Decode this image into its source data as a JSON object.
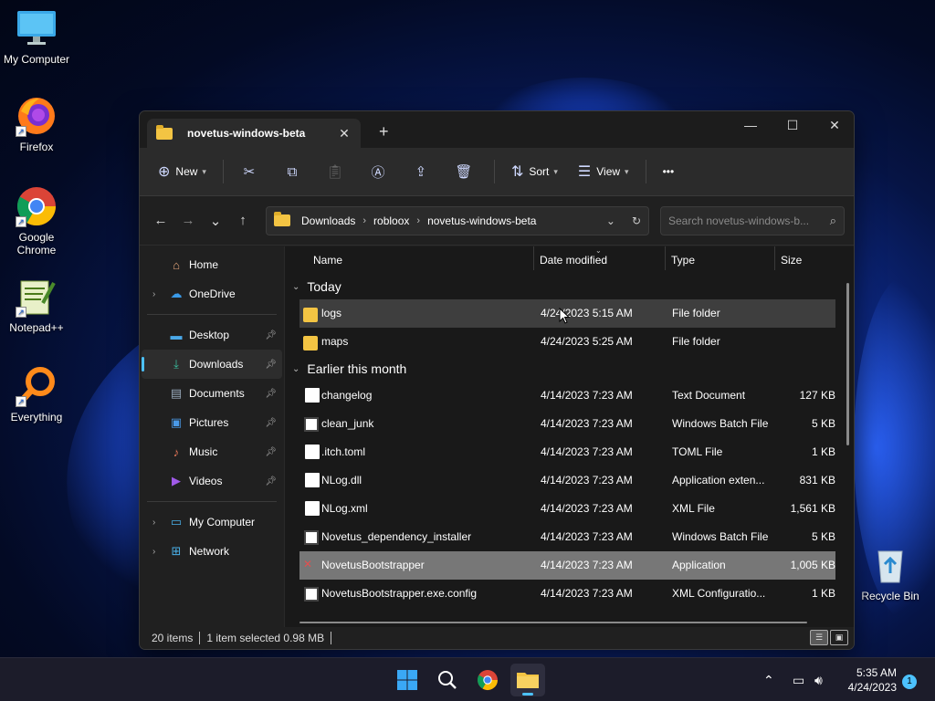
{
  "desktop": {
    "icons": [
      {
        "label": "My Computer",
        "icon": "monitor-icon"
      },
      {
        "label": "Firefox",
        "icon": "firefox-icon"
      },
      {
        "label": "Google Chrome",
        "icon": "chrome-icon"
      },
      {
        "label": "Notepad++",
        "icon": "notepadpp-icon"
      },
      {
        "label": "Everything",
        "icon": "everything-icon"
      },
      {
        "label": "Recycle Bin",
        "icon": "recycle-bin-icon"
      }
    ]
  },
  "window": {
    "tab_title": "novetus-windows-beta",
    "toolbar": {
      "new_label": "New",
      "sort_label": "Sort",
      "view_label": "View",
      "more_label": "•••"
    },
    "breadcrumb": [
      "Downloads",
      "robloox",
      "novetus-windows-beta"
    ],
    "search_placeholder": "Search novetus-windows-b...",
    "sidebar": {
      "top": [
        {
          "label": "Home",
          "icon": "home-icon"
        },
        {
          "label": "OneDrive",
          "icon": "cloud-icon"
        }
      ],
      "pinned": [
        {
          "label": "Desktop",
          "icon": "desktop-icon"
        },
        {
          "label": "Downloads",
          "icon": "download-icon"
        },
        {
          "label": "Documents",
          "icon": "documents-icon"
        },
        {
          "label": "Pictures",
          "icon": "pictures-icon"
        },
        {
          "label": "Music",
          "icon": "music-icon"
        },
        {
          "label": "Videos",
          "icon": "videos-icon"
        }
      ],
      "bottom": [
        {
          "label": "My Computer",
          "icon": "monitor-icon"
        },
        {
          "label": "Network",
          "icon": "network-icon"
        }
      ]
    },
    "columns": {
      "name": "Name",
      "date": "Date modified",
      "type": "Type",
      "size": "Size"
    },
    "groups": [
      {
        "label": "Today",
        "rows": [
          {
            "name": "logs",
            "date": "4/24/2023 5:15 AM",
            "type": "File folder",
            "size": "",
            "icon": "folder-icon"
          },
          {
            "name": "maps",
            "date": "4/24/2023 5:25 AM",
            "type": "File folder",
            "size": "",
            "icon": "folder-icon"
          }
        ]
      },
      {
        "label": "Earlier this month",
        "rows": [
          {
            "name": "changelog",
            "date": "4/14/2023 7:23 AM",
            "type": "Text Document",
            "size": "127 KB",
            "icon": "text-file-icon"
          },
          {
            "name": "clean_junk",
            "date": "4/14/2023 7:23 AM",
            "type": "Windows Batch File",
            "size": "5 KB",
            "icon": "batch-file-icon"
          },
          {
            "name": ".itch.toml",
            "date": "4/14/2023 7:23 AM",
            "type": "TOML File",
            "size": "1 KB",
            "icon": "blank-file-icon"
          },
          {
            "name": "NLog.dll",
            "date": "4/14/2023 7:23 AM",
            "type": "Application exten...",
            "size": "831 KB",
            "icon": "dll-file-icon"
          },
          {
            "name": "NLog.xml",
            "date": "4/14/2023 7:23 AM",
            "type": "XML File",
            "size": "1,561 KB",
            "icon": "blank-file-icon"
          },
          {
            "name": "Novetus_dependency_installer",
            "date": "4/14/2023 7:23 AM",
            "type": "Windows Batch File",
            "size": "5 KB",
            "icon": "batch-file-icon"
          },
          {
            "name": "NovetusBootstrapper",
            "date": "4/14/2023 7:23 AM",
            "type": "Application",
            "size": "1,005 KB",
            "icon": "app-icon"
          },
          {
            "name": "NovetusBootstrapper.exe.config",
            "date": "4/14/2023 7:23 AM",
            "type": "XML Configuratio...",
            "size": "1 KB",
            "icon": "config-file-icon"
          }
        ]
      }
    ],
    "status": {
      "count": "20 items",
      "selected": "1 item selected  0.98 MB"
    }
  },
  "taskbar": {
    "time": "5:35 AM",
    "date": "4/24/2023",
    "notification_count": "1"
  }
}
